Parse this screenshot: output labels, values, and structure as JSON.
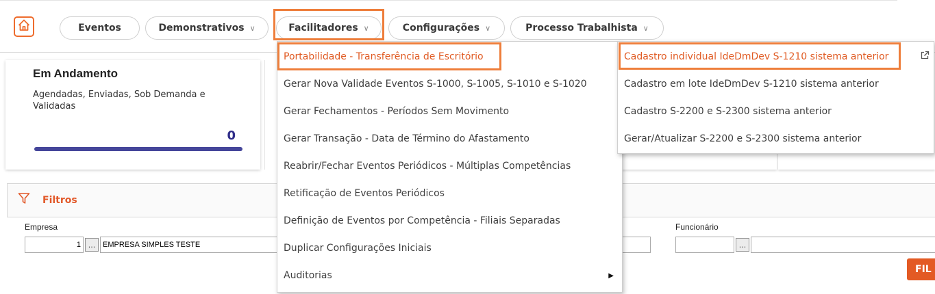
{
  "nav": {
    "items": [
      {
        "label": "Eventos",
        "chevron": false
      },
      {
        "label": "Demonstrativos",
        "chevron": true
      },
      {
        "label": "Facilitadores",
        "chevron": true
      },
      {
        "label": "Configurações",
        "chevron": true
      },
      {
        "label": "Processo Trabalhista",
        "chevron": true
      }
    ],
    "chevron_glyph": "∨"
  },
  "card": {
    "title": "Em Andamento",
    "subtitle": "Agendadas, Enviadas, Sob Demanda e Validadas",
    "count": "0"
  },
  "filters": {
    "title": "Filtros",
    "empresa_label": "Empresa",
    "empresa_code": "1",
    "empresa_name": "EMPRESA SIMPLES TESTE",
    "funcionario_label": "Funcionário",
    "funcionario_code": "",
    "funcionario_name": "",
    "dots_label": "...",
    "button_label": "FIL"
  },
  "facilitadores_menu": {
    "items": [
      "Portabilidade - Transferência de Escritório",
      "Gerar Nova Validade Eventos S-1000, S-1005, S-1010 e S-1020",
      "Gerar Fechamentos - Períodos Sem Movimento",
      "Gerar Transação - Data de Término do Afastamento",
      "Reabrir/Fechar Eventos Periódicos - Múltiplas Competências",
      "Retificação de Eventos Periódicos",
      "Definição de Eventos por Competência - Filiais Separadas",
      "Duplicar Configurações Iniciais",
      "Auditorias"
    ],
    "submenu_arrow": "▶"
  },
  "portabilidade_submenu": {
    "items": [
      "Cadastro individual IdeDmDev S-1210 sistema anterior",
      "Cadastro em lote IdeDmDev S-1210 sistema anterior",
      "Cadastro S-2200 e S-2300 sistema anterior",
      "Gerar/Atualizar S-2200 e S-2300 sistema anterior"
    ]
  },
  "colors": {
    "accent": "#e05a22",
    "highlight": "#ee7e3b",
    "progress": "#45469a"
  },
  "icons": {
    "home": "home-icon",
    "filter": "filter-icon",
    "external": "external-link-icon"
  }
}
